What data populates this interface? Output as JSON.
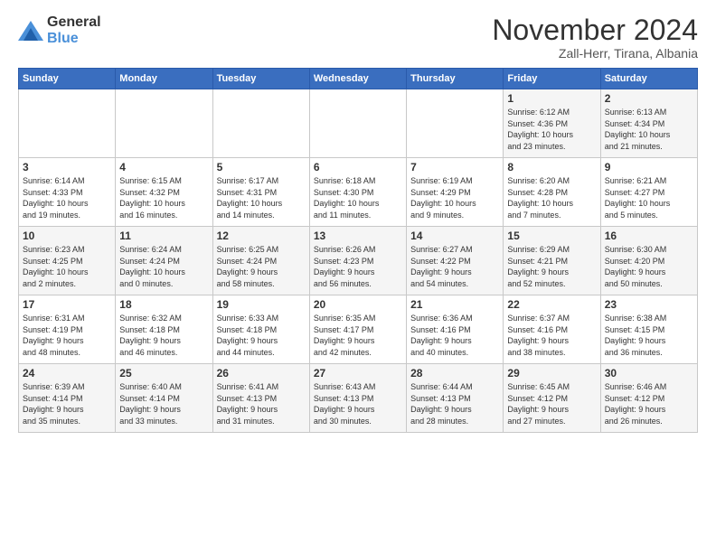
{
  "logo": {
    "general": "General",
    "blue": "Blue"
  },
  "header": {
    "month": "November 2024",
    "location": "Zall-Herr, Tirana, Albania"
  },
  "columns": [
    "Sunday",
    "Monday",
    "Tuesday",
    "Wednesday",
    "Thursday",
    "Friday",
    "Saturday"
  ],
  "weeks": [
    [
      {
        "day": "",
        "info": ""
      },
      {
        "day": "",
        "info": ""
      },
      {
        "day": "",
        "info": ""
      },
      {
        "day": "",
        "info": ""
      },
      {
        "day": "",
        "info": ""
      },
      {
        "day": "1",
        "info": "Sunrise: 6:12 AM\nSunset: 4:36 PM\nDaylight: 10 hours\nand 23 minutes."
      },
      {
        "day": "2",
        "info": "Sunrise: 6:13 AM\nSunset: 4:34 PM\nDaylight: 10 hours\nand 21 minutes."
      }
    ],
    [
      {
        "day": "3",
        "info": "Sunrise: 6:14 AM\nSunset: 4:33 PM\nDaylight: 10 hours\nand 19 minutes."
      },
      {
        "day": "4",
        "info": "Sunrise: 6:15 AM\nSunset: 4:32 PM\nDaylight: 10 hours\nand 16 minutes."
      },
      {
        "day": "5",
        "info": "Sunrise: 6:17 AM\nSunset: 4:31 PM\nDaylight: 10 hours\nand 14 minutes."
      },
      {
        "day": "6",
        "info": "Sunrise: 6:18 AM\nSunset: 4:30 PM\nDaylight: 10 hours\nand 11 minutes."
      },
      {
        "day": "7",
        "info": "Sunrise: 6:19 AM\nSunset: 4:29 PM\nDaylight: 10 hours\nand 9 minutes."
      },
      {
        "day": "8",
        "info": "Sunrise: 6:20 AM\nSunset: 4:28 PM\nDaylight: 10 hours\nand 7 minutes."
      },
      {
        "day": "9",
        "info": "Sunrise: 6:21 AM\nSunset: 4:27 PM\nDaylight: 10 hours\nand 5 minutes."
      }
    ],
    [
      {
        "day": "10",
        "info": "Sunrise: 6:23 AM\nSunset: 4:25 PM\nDaylight: 10 hours\nand 2 minutes."
      },
      {
        "day": "11",
        "info": "Sunrise: 6:24 AM\nSunset: 4:24 PM\nDaylight: 10 hours\nand 0 minutes."
      },
      {
        "day": "12",
        "info": "Sunrise: 6:25 AM\nSunset: 4:24 PM\nDaylight: 9 hours\nand 58 minutes."
      },
      {
        "day": "13",
        "info": "Sunrise: 6:26 AM\nSunset: 4:23 PM\nDaylight: 9 hours\nand 56 minutes."
      },
      {
        "day": "14",
        "info": "Sunrise: 6:27 AM\nSunset: 4:22 PM\nDaylight: 9 hours\nand 54 minutes."
      },
      {
        "day": "15",
        "info": "Sunrise: 6:29 AM\nSunset: 4:21 PM\nDaylight: 9 hours\nand 52 minutes."
      },
      {
        "day": "16",
        "info": "Sunrise: 6:30 AM\nSunset: 4:20 PM\nDaylight: 9 hours\nand 50 minutes."
      }
    ],
    [
      {
        "day": "17",
        "info": "Sunrise: 6:31 AM\nSunset: 4:19 PM\nDaylight: 9 hours\nand 48 minutes."
      },
      {
        "day": "18",
        "info": "Sunrise: 6:32 AM\nSunset: 4:18 PM\nDaylight: 9 hours\nand 46 minutes."
      },
      {
        "day": "19",
        "info": "Sunrise: 6:33 AM\nSunset: 4:18 PM\nDaylight: 9 hours\nand 44 minutes."
      },
      {
        "day": "20",
        "info": "Sunrise: 6:35 AM\nSunset: 4:17 PM\nDaylight: 9 hours\nand 42 minutes."
      },
      {
        "day": "21",
        "info": "Sunrise: 6:36 AM\nSunset: 4:16 PM\nDaylight: 9 hours\nand 40 minutes."
      },
      {
        "day": "22",
        "info": "Sunrise: 6:37 AM\nSunset: 4:16 PM\nDaylight: 9 hours\nand 38 minutes."
      },
      {
        "day": "23",
        "info": "Sunrise: 6:38 AM\nSunset: 4:15 PM\nDaylight: 9 hours\nand 36 minutes."
      }
    ],
    [
      {
        "day": "24",
        "info": "Sunrise: 6:39 AM\nSunset: 4:14 PM\nDaylight: 9 hours\nand 35 minutes."
      },
      {
        "day": "25",
        "info": "Sunrise: 6:40 AM\nSunset: 4:14 PM\nDaylight: 9 hours\nand 33 minutes."
      },
      {
        "day": "26",
        "info": "Sunrise: 6:41 AM\nSunset: 4:13 PM\nDaylight: 9 hours\nand 31 minutes."
      },
      {
        "day": "27",
        "info": "Sunrise: 6:43 AM\nSunset: 4:13 PM\nDaylight: 9 hours\nand 30 minutes."
      },
      {
        "day": "28",
        "info": "Sunrise: 6:44 AM\nSunset: 4:13 PM\nDaylight: 9 hours\nand 28 minutes."
      },
      {
        "day": "29",
        "info": "Sunrise: 6:45 AM\nSunset: 4:12 PM\nDaylight: 9 hours\nand 27 minutes."
      },
      {
        "day": "30",
        "info": "Sunrise: 6:46 AM\nSunset: 4:12 PM\nDaylight: 9 hours\nand 26 minutes."
      }
    ]
  ]
}
